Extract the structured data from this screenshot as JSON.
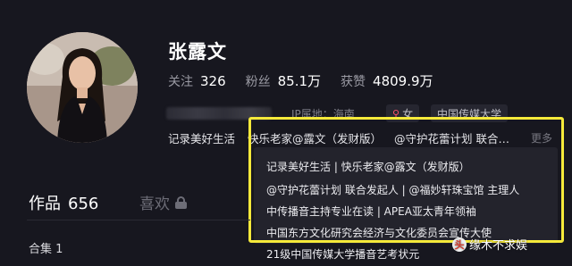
{
  "profile": {
    "name": "张露文",
    "stats": [
      {
        "label": "关注",
        "value": "326"
      },
      {
        "label": "粉丝",
        "value": "85.1万"
      },
      {
        "label": "获赞",
        "value": "4809.9万"
      }
    ],
    "ip_label": "IP属地：海南",
    "gender_icon": "location-pin-icon",
    "gender_label": "女",
    "school_tag": "中国传媒大学",
    "bio_preview": [
      "记录美好生活",
      "快乐老家@露文（发财版）",
      "@守护花蕾计划 联合…"
    ],
    "more_label": "更多"
  },
  "bio_popup": {
    "lines": [
      "记录美好生活 | 快乐老家@露文（发财版）",
      "@守护花蕾计划 联合发起人 | @福妙轩珠宝馆 主理人",
      "中传播音主持专业在读 | APEA亚太青年领袖",
      "中国东方文化研究会经济与文化委员会宣传大使",
      "21级中国传媒大学播音艺考状元"
    ]
  },
  "tabs": {
    "works_label": "作品",
    "works_count": "656",
    "likes_label": "喜欢",
    "likes_icon": "lock-icon"
  },
  "collection_label": "合集 1",
  "watermark": {
    "icon": "toutiao-logo-icon",
    "text": "缘木不求娱"
  },
  "colors": {
    "background": "#17171f",
    "highlight_frame": "#f5e93a",
    "gender_pin": "#ff4f6a"
  }
}
